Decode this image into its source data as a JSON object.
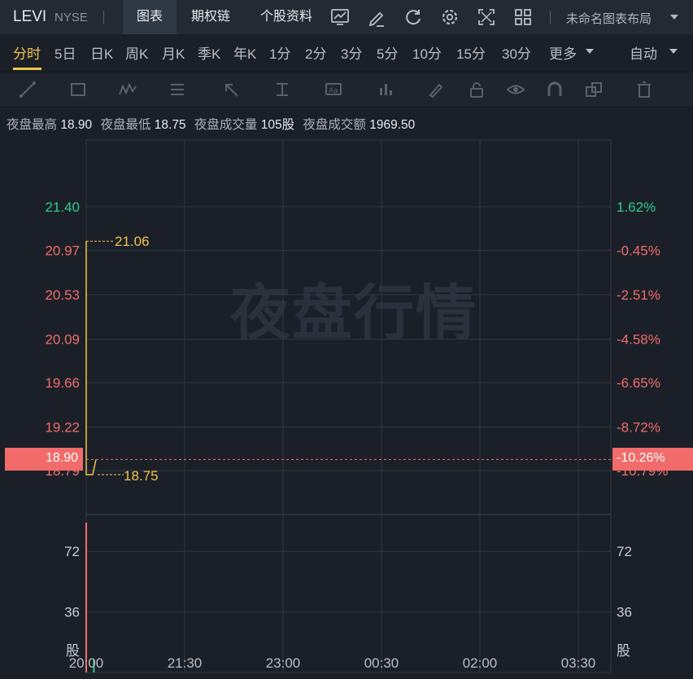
{
  "header": {
    "symbol": "LEVI",
    "exchange": "NYSE",
    "tabs": [
      "图表",
      "期权链",
      "个股资料"
    ],
    "active_tab": "图表",
    "layout_name": "未命名图表布局"
  },
  "periods": {
    "items": [
      "分时",
      "5日",
      "日K",
      "周K",
      "月K",
      "季K",
      "年K",
      "1分",
      "2分",
      "3分",
      "5分",
      "10分",
      "15分",
      "30分",
      "更多"
    ],
    "active": "分时",
    "mode": "自动"
  },
  "info": {
    "high_label": "夜盘最高",
    "high": "18.90",
    "low_label": "夜盘最低",
    "low": "18.75",
    "volume_label": "夜盘成交量",
    "volume": "105股",
    "amount_label": "夜盘成交额",
    "amount": "1969.50"
  },
  "watermark": "夜盘行情",
  "current": {
    "price": "18.90",
    "pct": "-10.26%"
  },
  "colors": {
    "up": "#2ecc8f",
    "down": "#f26b6b",
    "price_line": "#f3c34a",
    "accent": "#f3c34a"
  },
  "chart_data": {
    "type": "line",
    "x_ticks": [
      "20:00",
      "21:30",
      "23:00",
      "00:30",
      "02:00",
      "03:30"
    ],
    "price_ticks": [
      "21.40",
      "20.97",
      "20.53",
      "20.09",
      "19.66",
      "19.22",
      "18.79"
    ],
    "pct_ticks": [
      "1.62%",
      "-0.45%",
      "-2.51%",
      "-4.58%",
      "-6.65%",
      "-8.72%",
      "-10.79%"
    ],
    "price_ylim": [
      18.79,
      21.4
    ],
    "series": [
      {
        "x": [
          "20:00",
          "20:00",
          "20:05",
          "20:07"
        ],
        "y": [
          21.06,
          18.75,
          18.75,
          18.9
        ]
      }
    ],
    "max_label": "21.06",
    "min_label": "18.75",
    "volume": {
      "ticks": [
        "72",
        "36"
      ],
      "unit": "股",
      "ylim": [
        0,
        90
      ],
      "bars": [
        {
          "x": "20:00",
          "value": 105
        },
        {
          "x": "20:07",
          "value": 8
        }
      ]
    }
  }
}
